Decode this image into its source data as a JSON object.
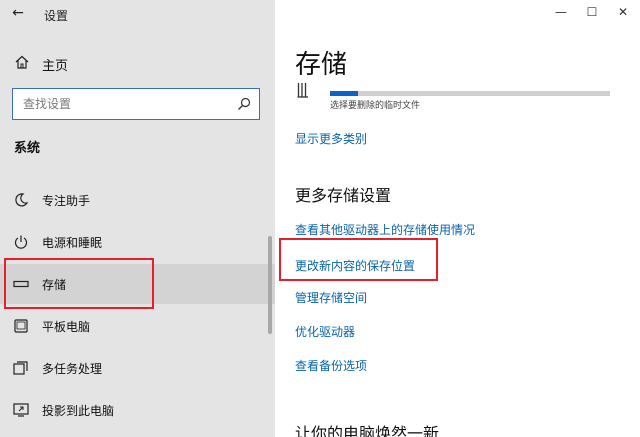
{
  "window": {
    "title": "设置",
    "minimize": "—",
    "maximize": "☐",
    "close": "✕"
  },
  "sidebar": {
    "home": "主页",
    "search_placeholder": "查找设置",
    "section": "系统",
    "items": [
      {
        "label": "专注助手",
        "icon": "moon-icon"
      },
      {
        "label": "电源和睡眠",
        "icon": "power-icon"
      },
      {
        "label": "存储",
        "icon": "storage-icon",
        "selected": true
      },
      {
        "label": "平板电脑",
        "icon": "tablet-icon"
      },
      {
        "label": "多任务处理",
        "icon": "multitask-icon"
      },
      {
        "label": "投影到此电脑",
        "icon": "project-icon"
      }
    ]
  },
  "main": {
    "title": "存储",
    "storage_bar": {
      "text": "选择要删除的临时文件",
      "fill_percent": 10
    },
    "show_more": "显示更多类别",
    "more_settings_title": "更多存储设置",
    "links": [
      "查看其他驱动器上的存储使用情况",
      "更改新内容的保存位置",
      "管理存储空间",
      "优化驱动器",
      "查看备份选项"
    ],
    "bottom_heading": "让你的电脑焕然一新"
  },
  "colors": {
    "link": "#0a64a8",
    "accent": "#0a64c8",
    "highlight": "#e3202b",
    "sidebar_bg": "#e4e4e4"
  }
}
